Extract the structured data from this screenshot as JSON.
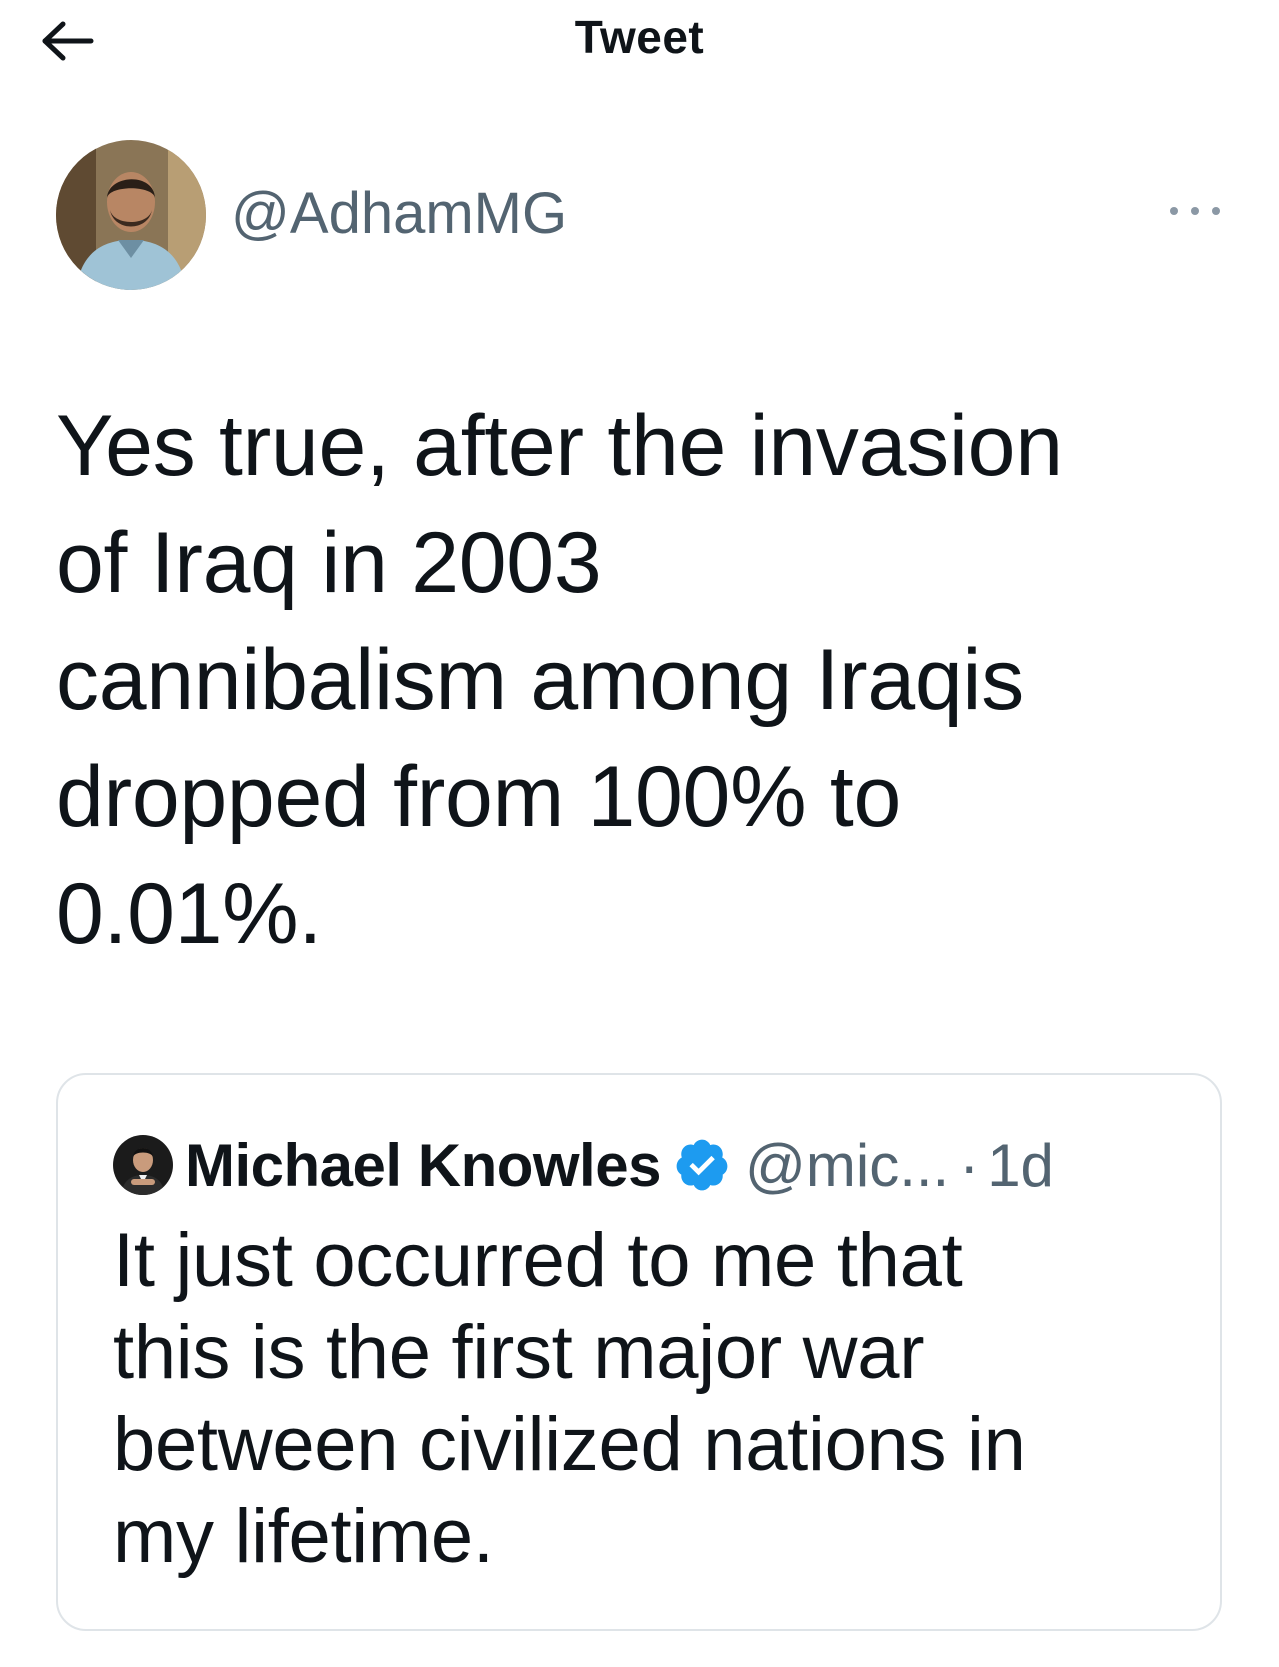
{
  "header": {
    "title": "Tweet",
    "back_icon": "arrow-left-icon"
  },
  "tweet": {
    "author_handle": "@AdhamMG",
    "avatar_icon": "user-avatar",
    "more_icon": "more-dots-icon",
    "text": "Yes true, after the invasion\nof Iraq in 2003\ncannibalism among Iraqis\ndropped from 100% to\n0.01%."
  },
  "quoted_tweet": {
    "author_name": "Michael Knowles",
    "verified_icon": "verified-badge-icon",
    "author_handle": "@mic...",
    "separator": "·",
    "time": "1d",
    "text": "It just occurred to me that\nthis is the first major war\nbetween civilized nations in\nmy lifetime."
  },
  "colors": {
    "text_primary": "#0f1419",
    "text_secondary": "#536471",
    "verified_blue": "#1d9bf0",
    "card_border": "#dfe4e8"
  }
}
